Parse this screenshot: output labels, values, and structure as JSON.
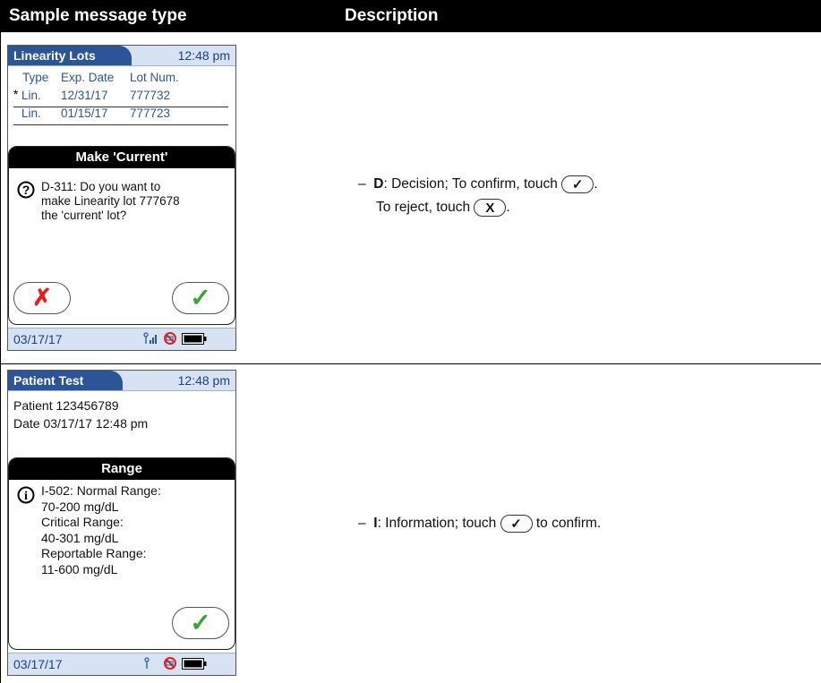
{
  "header": {
    "col1": "Sample message type",
    "col2": "Description"
  },
  "row1": {
    "screen": {
      "tab_title": "Linearity Lots",
      "time": "12:48 pm",
      "columns": [
        "Type",
        "Exp. Date",
        "Lot Num."
      ],
      "rows": [
        {
          "marker": "*",
          "type": "Lin.",
          "exp": "12/31/17",
          "lot": "777732"
        },
        {
          "marker": "",
          "type": "Lin.",
          "exp": "01/15/17",
          "lot": "777723"
        }
      ],
      "dialog_title": "Make 'Current'",
      "icon": "question-icon",
      "message": [
        "D-311: Do you want to",
        "make Linearity lot 777678",
        "the 'current' lot?"
      ],
      "footer_date": "03/17/17"
    },
    "description": {
      "dash": "–",
      "code": "D",
      "line1": ": Decision; To confirm, touch",
      "line2": "To reject, touch",
      "period": "."
    }
  },
  "row2": {
    "screen": {
      "tab_title": "Patient Test",
      "time": "12:48 pm",
      "patient": "Patient 123456789",
      "date_line": "Date 03/17/17 12:48 pm",
      "dialog_title": "Range",
      "icon": "info-icon",
      "message": [
        "I-502:  Normal Range:",
        "70-200 mg/dL",
        "Critical Range:",
        "40-301 mg/dL",
        "Reportable Range:",
        "11-600 mg/dL"
      ],
      "footer_date": "03/17/17"
    },
    "description": {
      "dash": "–",
      "code": "I",
      "text_before": ": Information; touch",
      "text_after": "to confirm."
    }
  },
  "glyphs": {
    "check": "✓",
    "cross": "X",
    "cross_red": "✗",
    "check_green": "✓"
  },
  "colors": {
    "tab_blue": "#2c5597",
    "bar_light_blue": "#d7e3f3",
    "confirm_green": "#3aa435",
    "reject_red": "#e0201b"
  }
}
